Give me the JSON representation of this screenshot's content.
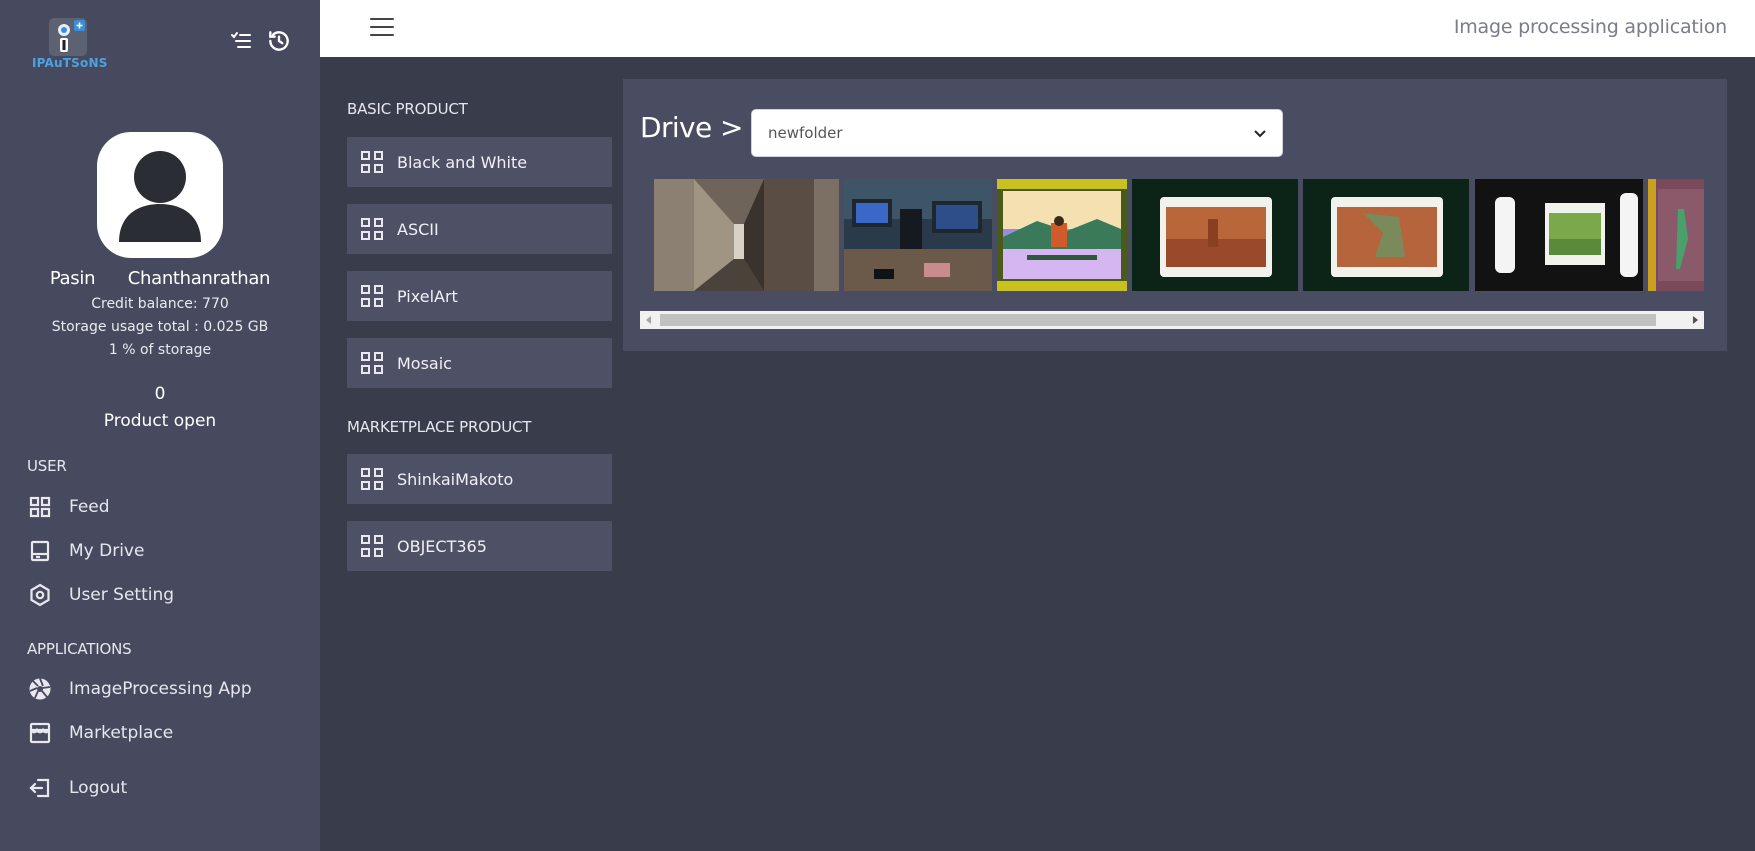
{
  "app": {
    "logo_text": "IPAuTSoNS",
    "header_title": "Image processing application"
  },
  "profile": {
    "name": "Pasin      Chanthanrathan",
    "credit": "Credit balance: 770",
    "storage": "Storage usage total : 0.025 GB",
    "storage_percent": "1 % of storage",
    "product_count": "0",
    "product_open": "Product open"
  },
  "sidebar": {
    "user_heading": "USER",
    "user_items": [
      {
        "label": "Feed",
        "icon": "grid-icon"
      },
      {
        "label": "My Drive",
        "icon": "drive-icon"
      },
      {
        "label": "User Setting",
        "icon": "hexagon-settings-icon"
      }
    ],
    "apps_heading": "APPLICATIONS",
    "app_items": [
      {
        "label": "ImageProcessing App",
        "icon": "aperture-icon"
      },
      {
        "label": "Marketplace",
        "icon": "store-icon"
      }
    ],
    "logout": "Logout"
  },
  "products": {
    "basic_heading": "BASIC PRODUCT",
    "basic": [
      "Black and White",
      "ASCII",
      "PixelArt",
      "Mosaic"
    ],
    "market_heading": "MARKETPLACE PRODUCT",
    "market": [
      "ShinkaiMakoto",
      "OBJECT365"
    ]
  },
  "drive": {
    "label": "Drive >",
    "selected_folder": "newfolder",
    "thumbnails": [
      "hallway-photo",
      "computer-lab-photo",
      "person-on-bench-film-photo",
      "film-negative-orange-photo",
      "film-negative-orange-photo-2",
      "film-strip-green-photo",
      "film-strip-pink-photo"
    ]
  },
  "colors": {
    "sidebar_bg": "#474a5e",
    "main_bg": "#393c4b",
    "panel_bg": "#4a4d61",
    "button_bg": "#4e5165",
    "logo_blue": "#4aa3e0"
  }
}
